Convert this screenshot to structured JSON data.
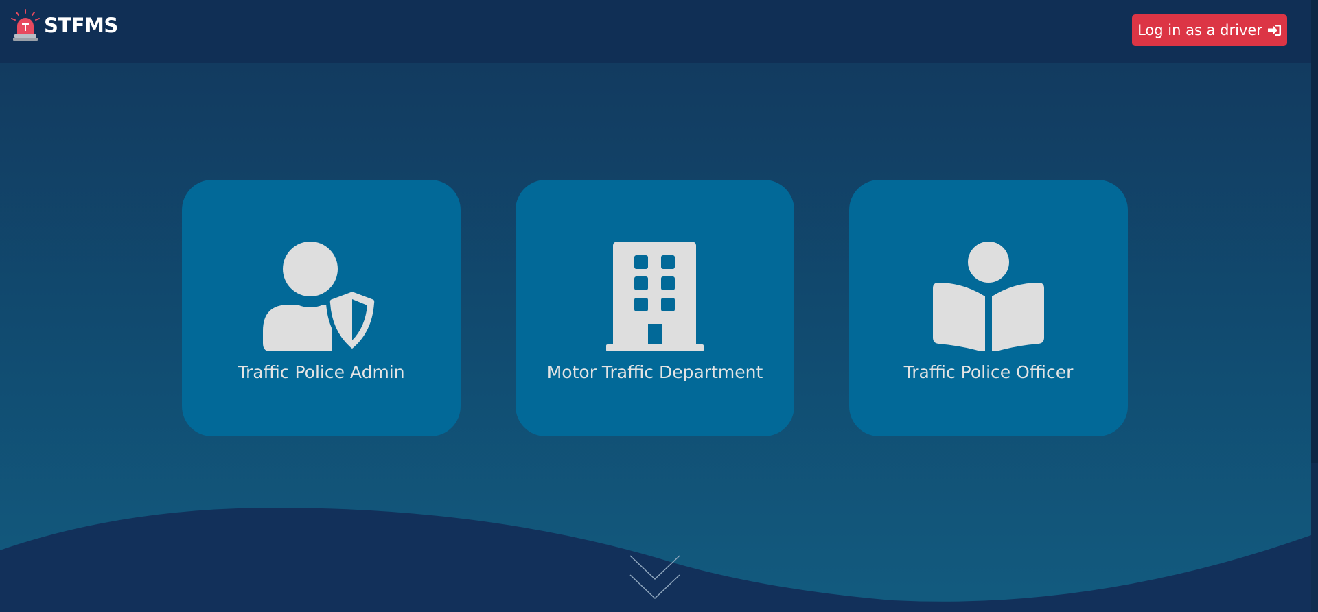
{
  "app": {
    "brand_name": "STFMS",
    "logo_icon": "siren-icon"
  },
  "header": {
    "login_driver_label": "Log in as a driver",
    "login_icon": "sign-in-icon",
    "login_color": "#dc3545"
  },
  "cards": [
    {
      "label": "Traffic Police Admin",
      "icon": "user-shield-icon"
    },
    {
      "label": "Motor Traffic Department",
      "icon": "building-icon"
    },
    {
      "label": "Traffic Police Officer",
      "icon": "book-reader-icon"
    }
  ],
  "colors": {
    "navbar": "#102f55",
    "card": "#026998",
    "icon": "#dedede",
    "wave": "#12305a"
  },
  "scroll_hint_icon": "double-chevron-down-icon"
}
